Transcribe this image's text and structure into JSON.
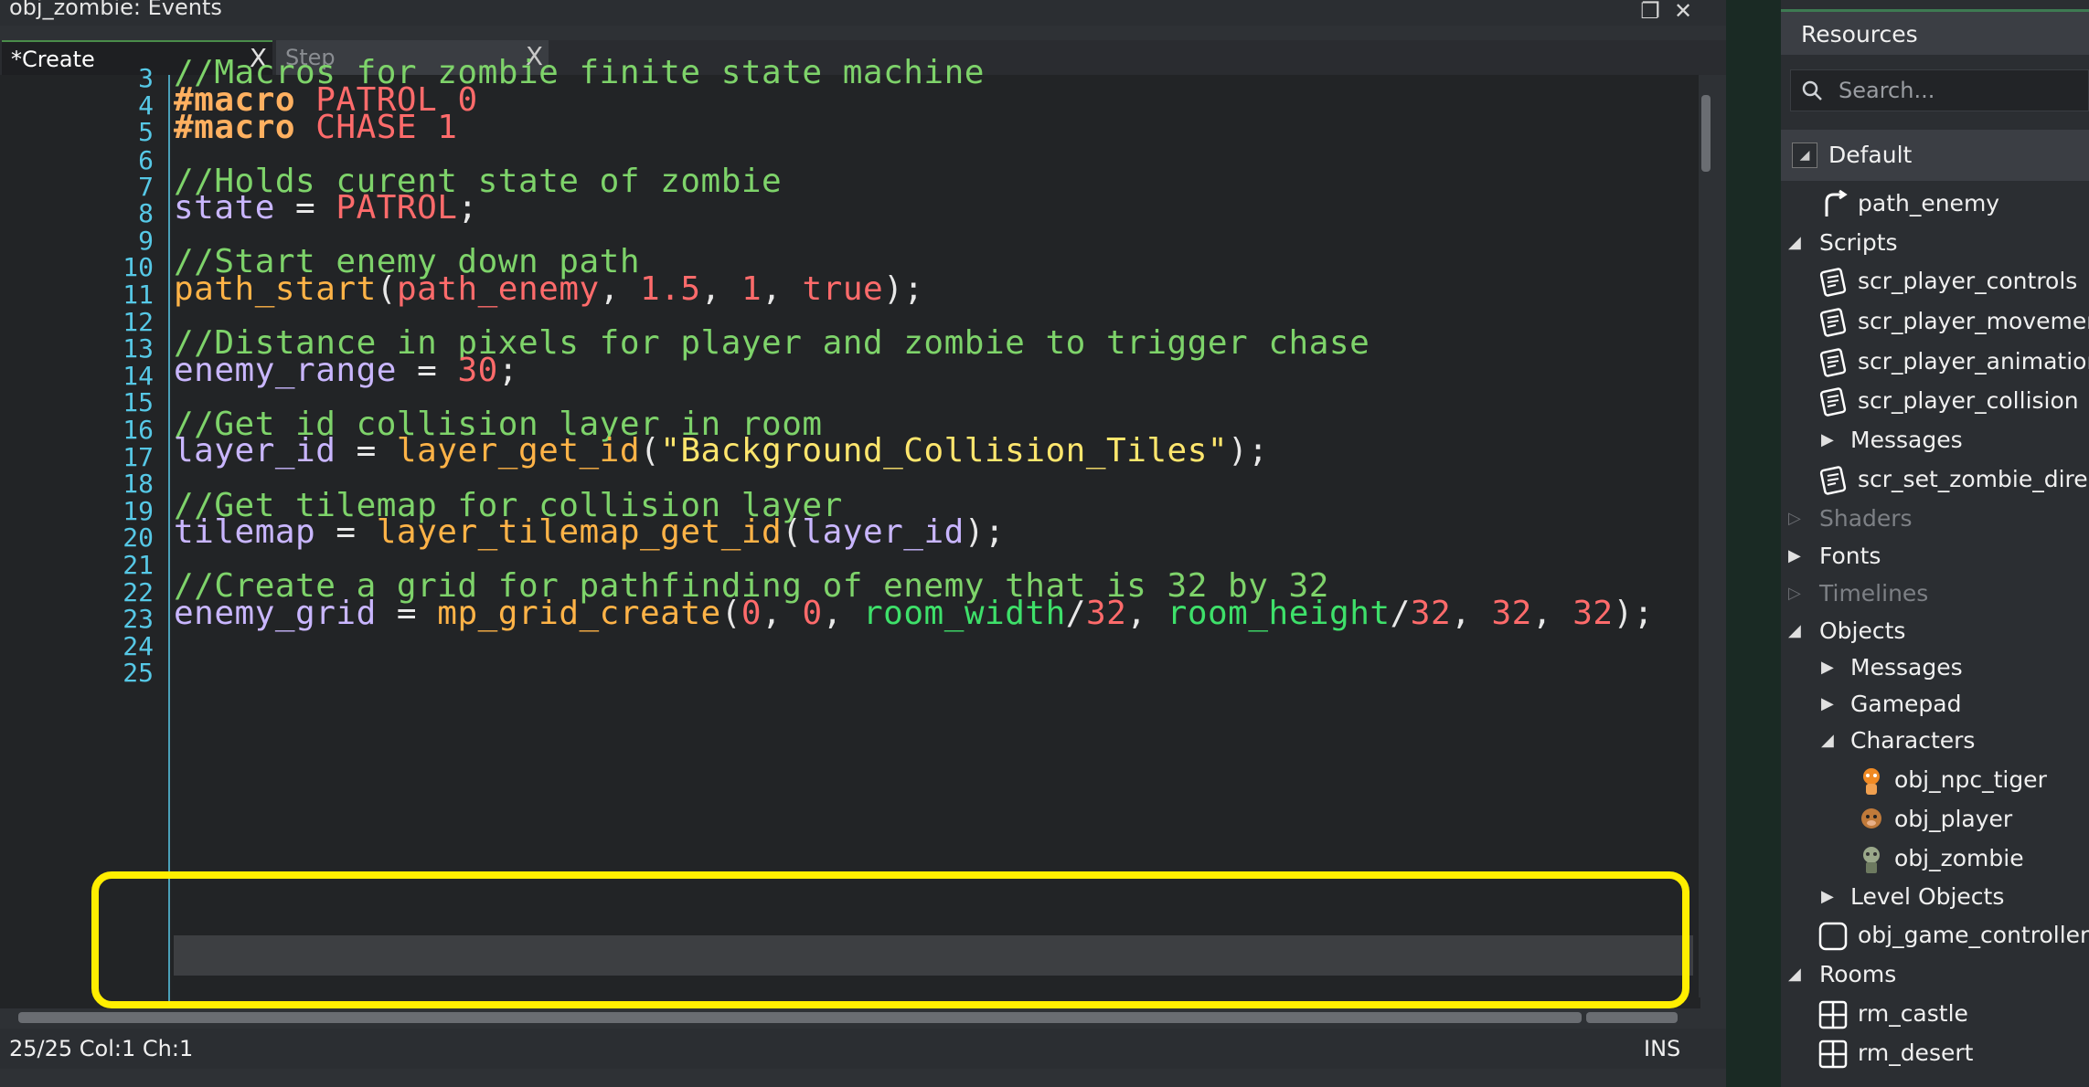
{
  "window": {
    "title": "obj_zombie: Events",
    "restore_glyph": "❐",
    "close_glyph": "✕"
  },
  "tabs": [
    {
      "label": "*Create",
      "close": "X"
    },
    {
      "label": "Step",
      "close": "X"
    }
  ],
  "code": {
    "line_numbers": [
      "3",
      "4",
      "5",
      "6",
      "7",
      "8",
      "9",
      "10",
      "11",
      "12",
      "13",
      "14",
      "15",
      "16",
      "17",
      "18",
      "19",
      "20",
      "21",
      "22",
      "23",
      "24",
      "25"
    ],
    "lines": {
      "l3": "//Macros for zombie finite state machine",
      "l4_kw": "#macro",
      "l4_name": "PATROL",
      "l4_val": "0",
      "l5_kw": "#macro",
      "l5_name": "CHASE",
      "l5_val": "1",
      "l7": "//Holds curent state of zombie",
      "l8_var": "state",
      "l8_op": " = ",
      "l8_val": "PATROL",
      "l8_end": ";",
      "l10": "//Start enemy down path",
      "l11_fn": "path_start",
      "l11_p1": "(",
      "l11_arg1": "path_enemy",
      "l11_c1": ", ",
      "l11_arg2": "1.5",
      "l11_c2": ", ",
      "l11_arg3": "1",
      "l11_c3": ", ",
      "l11_arg4": "true",
      "l11_end": ");",
      "l13": "//Distance in pixels for player and zombie to trigger chase",
      "l14_var": "enemy_range",
      "l14_op": " = ",
      "l14_val": "30",
      "l14_end": ";",
      "l16": "//Get id collision layer in room",
      "l17_var": "layer_id",
      "l17_op": " = ",
      "l17_fn": "layer_get_id",
      "l17_p1": "(",
      "l17_str": "\"Background_Collision_Tiles\"",
      "l17_end": ");",
      "l19": "//Get tilemap for collision layer",
      "l20_var": "tilemap",
      "l20_op": " = ",
      "l20_fn": "layer_tilemap_get_id",
      "l20_p1": "(",
      "l20_arg": "layer_id",
      "l20_end": ");",
      "l22": "//Create a grid for pathfinding of enemy that is 32 by 32",
      "l23_var": "enemy_grid",
      "l23_op": " = ",
      "l23_fn": "mp_grid_create",
      "l23_p1": "(",
      "l23_a1": "0",
      "l23_c1": ", ",
      "l23_a2": "0",
      "l23_c2": ", ",
      "l23_b1": "room_width",
      "l23_s1": "/",
      "l23_a3": "32",
      "l23_c3": ", ",
      "l23_b2": "room_height",
      "l23_s2": "/",
      "l23_a4": "32",
      "l23_c4": ", ",
      "l23_a5": "32",
      "l23_c5": ", ",
      "l23_a6": "32",
      "l23_end": ");"
    }
  },
  "status": {
    "position": "25/25 Col:1 Ch:1",
    "mode": "INS"
  },
  "resources": {
    "header": "Resources",
    "search_placeholder": "Search...",
    "group": "Default",
    "items": {
      "path_enemy": "path_enemy",
      "scripts": "Scripts",
      "scr_player_controls": "scr_player_controls",
      "scr_player_movement": "scr_player_movement",
      "scr_player_animation": "scr_player_animation",
      "scr_player_collision": "scr_player_collision",
      "messages_scripts": "Messages",
      "scr_set_zombie_direction": "scr_set_zombie_directio",
      "shaders": "Shaders",
      "fonts": "Fonts",
      "timelines": "Timelines",
      "objects": "Objects",
      "messages_objects": "Messages",
      "gamepad": "Gamepad",
      "characters": "Characters",
      "obj_npc_tiger": "obj_npc_tiger",
      "obj_player": "obj_player",
      "obj_zombie": "obj_zombie",
      "level_objects": "Level Objects",
      "obj_game_controller": "obj_game_controller",
      "rooms": "Rooms",
      "rm_castle": "rm_castle",
      "rm_desert": "rm_desert"
    }
  },
  "colors": {
    "comment": "#7ed36a",
    "macro": "#ffb060",
    "number": "#ff6b6b",
    "variable": "#c9b6ff",
    "function": "#ffb347",
    "string": "#ffe66d",
    "builtin": "#3ee06a",
    "line_number": "#56c8e6",
    "highlight_box": "#ffee00"
  },
  "icons": [
    "restore-icon",
    "close-icon",
    "search-icon",
    "path-icon",
    "script-icon",
    "folder-arrow-icon",
    "sprite-icon",
    "room-icon",
    "object-icon"
  ]
}
